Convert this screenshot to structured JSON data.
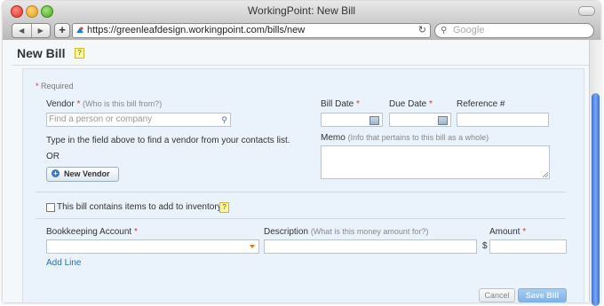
{
  "window": {
    "title": "WorkingPoint: New Bill"
  },
  "browser": {
    "url": "https://greenleafdesign.workingpoint.com/bills/new",
    "search_placeholder": "Google",
    "back_glyph": "◀",
    "forward_glyph": "▶",
    "add_glyph": "+",
    "reload_glyph": "↻",
    "search_glyph": "⚲"
  },
  "page": {
    "title": "New Bill",
    "help_glyph": "?",
    "required_note": "Required",
    "required_star": "*"
  },
  "vendor": {
    "label": "Vendor",
    "hint": "(Who is this bill from?)",
    "placeholder": "Find a person or company",
    "instruction": "Type in the field above to find a vendor from your contacts list.",
    "or_text": "OR",
    "new_vendor_label": "New Vendor",
    "new_vendor_icon": "+"
  },
  "dates": {
    "bill_date_label": "Bill Date",
    "due_date_label": "Due Date",
    "reference_label": "Reference #"
  },
  "memo": {
    "label": "Memo",
    "hint": "(Info that pertains to this bill as a whole)"
  },
  "inventory": {
    "label": "This bill contains items to add to inventory",
    "checked": false
  },
  "line_items": {
    "account_label": "Bookkeeping Account",
    "description_label": "Description",
    "description_hint": "(What is this money amount for?)",
    "amount_label": "Amount",
    "currency_symbol": "$",
    "add_line_label": "Add Line"
  },
  "actions": {
    "cancel_label": "Cancel",
    "save_label": "Save Bill"
  },
  "colors": {
    "required_star": "#d23b2b",
    "link": "#2a6fb5",
    "panel_bg": "#eaf2fb",
    "save_button": "#7fb2e6"
  }
}
